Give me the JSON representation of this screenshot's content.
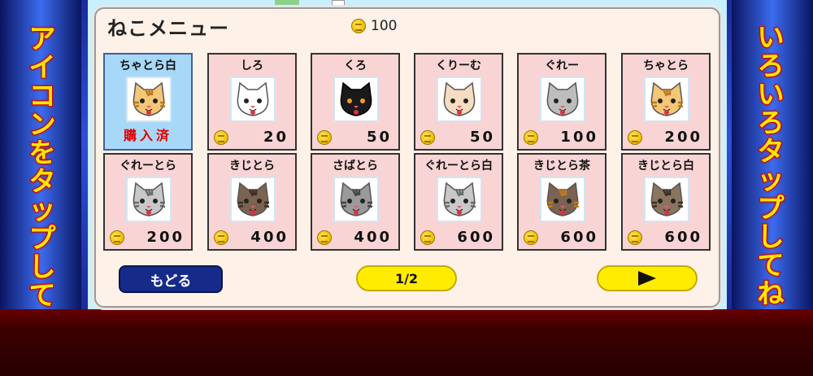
{
  "side_text": {
    "left": "アイコンをタップしてね",
    "right": "いろいろタップしてね"
  },
  "menu": {
    "title": "ねこメニュー",
    "coins": "100",
    "coin_icon": "coin-icon"
  },
  "cats": [
    {
      "name": "ちゃとら白",
      "price": "",
      "owned": true,
      "owned_label": "購入済",
      "color": "#f3c776",
      "stripe": "#b87a20"
    },
    {
      "name": "しろ",
      "price": "20",
      "owned": false,
      "color": "#ffffff",
      "stripe": ""
    },
    {
      "name": "くろ",
      "price": "50",
      "owned": false,
      "color": "#1a1a1a",
      "stripe": ""
    },
    {
      "name": "くりーむ",
      "price": "50",
      "owned": false,
      "color": "#f6dcc0",
      "stripe": ""
    },
    {
      "name": "ぐれー",
      "price": "100",
      "owned": false,
      "color": "#bdbdbd",
      "stripe": ""
    },
    {
      "name": "ちゃとら",
      "price": "200",
      "owned": false,
      "color": "#f3c776",
      "stripe": "#b87a20"
    },
    {
      "name": "ぐれーとら",
      "price": "200",
      "owned": false,
      "color": "#c8c8c8",
      "stripe": "#6a6a6a"
    },
    {
      "name": "きじとら",
      "price": "400",
      "owned": false,
      "color": "#7a6350",
      "stripe": "#3c2e20"
    },
    {
      "name": "さばとら",
      "price": "400",
      "owned": false,
      "color": "#9a9a9a",
      "stripe": "#444444"
    },
    {
      "name": "ぐれーとら白",
      "price": "600",
      "owned": false,
      "color": "#c8c8c8",
      "stripe": "#6a6a6a"
    },
    {
      "name": "きじとら茶",
      "price": "600",
      "owned": false,
      "color": "#7a6350",
      "stripe": "#c07a20"
    },
    {
      "name": "きじとら白",
      "price": "600",
      "owned": false,
      "color": "#8a7560",
      "stripe": "#3c2e20"
    }
  ],
  "buttons": {
    "back": "もどる",
    "page": "1/2",
    "next_icon": "play-triangle-icon"
  }
}
